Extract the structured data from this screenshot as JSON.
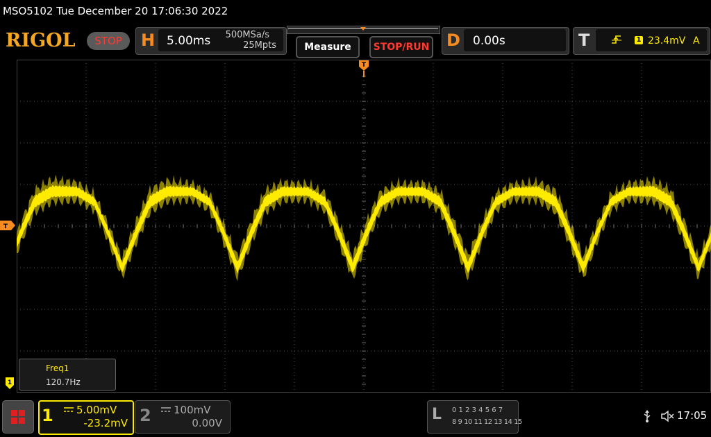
{
  "header": {
    "model_datetime": "MSO5102  Tue December 20 17:06:30 2022",
    "logo": "RIGOL",
    "run_state": "STOP"
  },
  "horizontal": {
    "letter": "H",
    "timebase": "5.00ms",
    "sample_rate": "500MSa/s",
    "memory_depth": "25Mpts"
  },
  "buttons": {
    "measure": "Measure",
    "stop_run": "STOP/RUN"
  },
  "delay": {
    "letter": "D",
    "value": "0.00s"
  },
  "trigger": {
    "letter": "T",
    "source_badge": "1",
    "level": "23.4mV",
    "mode": "A",
    "marker": "T"
  },
  "measurement": {
    "label": "Freq1",
    "value": "120.7Hz"
  },
  "channel1": {
    "number": "1",
    "scale": "5.00mV",
    "offset": "-23.2mV",
    "marker": "1",
    "color": "#ffeb00"
  },
  "channel2": {
    "number": "2",
    "scale": "100mV",
    "offset": "0.00V"
  },
  "logic": {
    "letter": "L",
    "row1": "0 1 2 3  4 5 6 7",
    "row2": "8 9 10 11 12 13 14 15"
  },
  "status": {
    "clock": "17:05"
  },
  "icons": {
    "menu": "app-menu-icon",
    "usb": "usb-icon",
    "speaker": "speaker-muted-icon",
    "trigger_edge": "rising-edge-icon"
  },
  "colors": {
    "trace": "#ffeb00",
    "accent": "#f68b1f",
    "stop": "#ff3a30"
  }
}
